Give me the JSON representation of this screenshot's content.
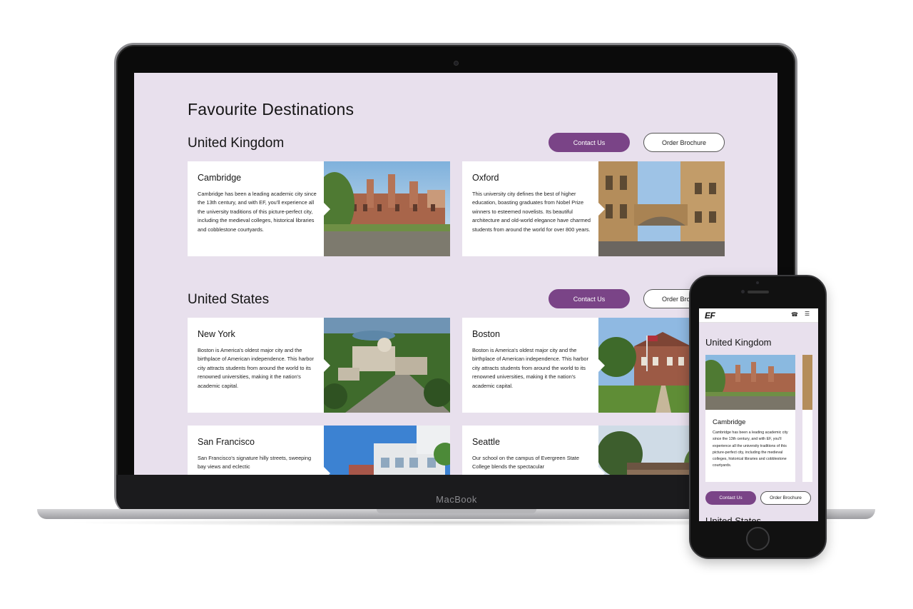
{
  "page_title": "Favourite Destinations",
  "sections": [
    {
      "heading": "United Kingdom",
      "contact_label": "Contact Us",
      "brochure_label": "Order Brochure",
      "cards": [
        {
          "city": "Cambridge",
          "description": "Cambridge has been a leading academic city since the 13th century, and with EF, you'll experience all the university traditions of this picture-perfect city, including the medieval colleges, historical libraries and cobblestone courtyards.",
          "image": "cambridge-college-photo"
        },
        {
          "city": "Oxford",
          "description": "This university city defines the best of higher education, boasting graduates from Nobel Prize winners to esteemed novelists. Its beautiful architecture and old-world elegance have charmed students from around the world for over 800 years.",
          "image": "oxford-bridge-photo"
        }
      ]
    },
    {
      "heading": "United States",
      "contact_label": "Contact Us",
      "brochure_label": "Order Bro",
      "cards": [
        {
          "city": "New York",
          "description": "Boston is America's oldest major city and the birthplace of American independence. This harbor city attracts students from around the world to its renowned universities, making it the nation's academic capital.",
          "image": "new-york-campus-photo"
        },
        {
          "city": "Boston",
          "description": "Boston is America's oldest major city and the birthplace of American independence. This harbor city attracts students from around the world to its renowned universities, making it the nation's academic capital.",
          "image": "boston-campus-photo"
        },
        {
          "city": "San Francisco",
          "description": "San Francisco's signature hilly streets, sweeping bay views and eclectic",
          "image": "san-francisco-building-photo"
        },
        {
          "city": "Seattle",
          "description": "Our school on the campus of Evergreen State College blends the spectacular",
          "image": "seattle-campus-photo"
        }
      ]
    }
  ],
  "device_label": "MacBook",
  "mobile": {
    "logo": "EF",
    "phone_icon": "phone-icon",
    "menu_icon": "menu-icon",
    "section_heading": "United Kingdom",
    "card_city": "Cambridge",
    "card_description": "Cambridge has been a leading academic city since the 13th century, and with EF, you'll experience all the university traditions of this picture-perfect city, including the medieval colleges, historical libraries and cobblestone courtyards.",
    "contact_label": "Contact Us",
    "brochure_label": "Order Brochure",
    "next_section_heading": "United States"
  },
  "colors": {
    "screen_background": "#e8e0ed",
    "primary_button": "#7a4487",
    "card_background": "#ffffff"
  }
}
